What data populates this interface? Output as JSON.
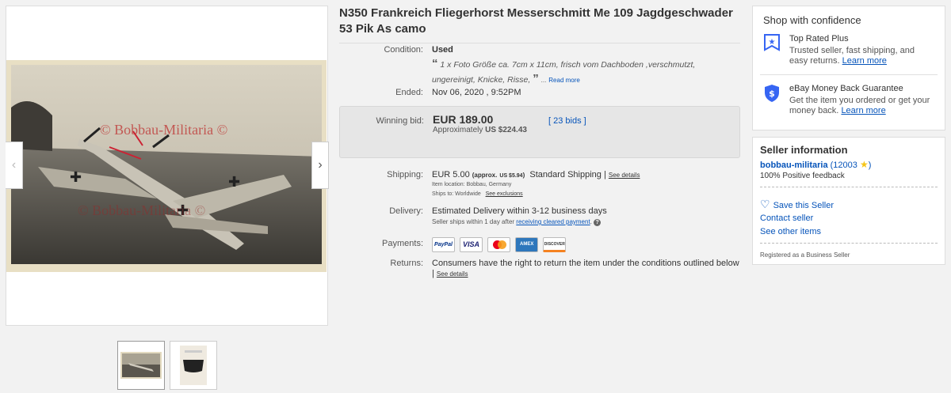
{
  "item": {
    "title": "N350 Frankreich Fliegerhorst Messerschmitt Me 109 Jagdgeschwader 53 Pik As camo",
    "watermark": "© Bobbau-Militaria ©"
  },
  "details": {
    "condition_label": "Condition:",
    "condition_value": "Used",
    "condition_desc_open": "“",
    "condition_desc": "1 x Foto Größe ca. 7cm x 11cm, frisch vom Dachboden ,verschmutzt, ungereinigt, Knicke, Risse,",
    "condition_desc_close": "”",
    "condition_ellipsis": "...",
    "read_more": "Read more",
    "ended_label": "Ended:",
    "ended_value": "Nov 06, 2020 , 9:52PM",
    "winning_label": "Winning bid:",
    "winning_price": "EUR 189.00",
    "approx_label": "Approximately",
    "approx_value": "US $224.43",
    "bids_open": "[",
    "bids": "23 bids",
    "bids_close": "]",
    "shipping_label": "Shipping:",
    "shipping_price": "EUR 5.00",
    "shipping_approx_open": "(approx.",
    "shipping_approx_value": "US $5.94",
    "shipping_approx_close": ")",
    "shipping_method": "Standard Shipping |",
    "see_details": "See details",
    "item_location": "Item location:  Bobbau, Germany",
    "ships_to": "Ships to:  Worldwide",
    "see_exclusions": "See exclusions",
    "delivery_label": "Delivery:",
    "delivery_value": "Estimated Delivery within 3-12 business days",
    "seller_ships": "Seller ships within 1 day after",
    "receiving_payment": "receiving cleared payment",
    "seller_ships_end": ".",
    "payments_label": "Payments:",
    "payment_logos": [
      "PayPal",
      "VISA",
      "MasterCard",
      "AMEX",
      "DISCOVER"
    ],
    "returns_label": "Returns:",
    "returns_value": "Consumers have the right to return the item under the conditions outlined below",
    "returns_pipe": "|",
    "returns_see_details": "See details"
  },
  "confidence": {
    "title": "Shop with confidence",
    "trp_title": "Top Rated Plus",
    "trp_desc": "Trusted seller, fast shipping, and easy returns.",
    "trp_link": "Learn more",
    "mbg_title": "eBay Money Back Guarantee",
    "mbg_desc": "Get the item you ordered or get your money back.",
    "mbg_link": "Learn more"
  },
  "seller": {
    "heading": "Seller information",
    "name": "bobbau-militaria",
    "score_open": "(",
    "score": "12003",
    "score_close": ")",
    "feedback": "100% Positive feedback",
    "save": "Save this Seller",
    "contact": "Contact seller",
    "other_items": "See other items",
    "registered": "Registered as a Business Seller"
  },
  "colors": {
    "link": "#0654ba",
    "paypal": "#003087",
    "visa": "#1a1f71",
    "amex": "#2e77bc",
    "discover": "#f58220",
    "star": "#f5c518"
  },
  "icons": {
    "prev": "‹",
    "next": "›",
    "heart": "♡"
  }
}
